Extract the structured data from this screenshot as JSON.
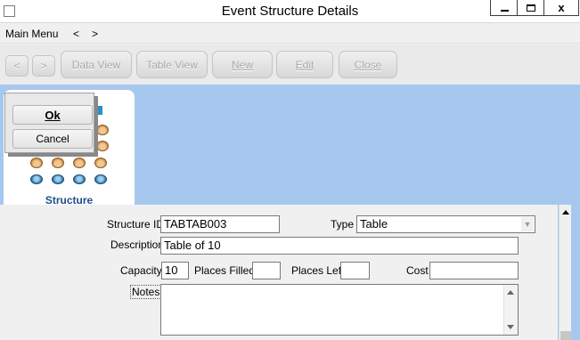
{
  "window": {
    "title": "Event Structure Details",
    "minimize_glyph": "",
    "close_glyph": "x"
  },
  "menu": {
    "main_menu": "Main Menu",
    "back": "<",
    "forward": ">"
  },
  "toolbar": {
    "prev": "<",
    "next": ">",
    "data_view": "Data View",
    "table_view": "Table View",
    "new": "New",
    "edit": "Edit",
    "close": "Close"
  },
  "popup": {
    "ok": "Ok",
    "cancel": "Cancel"
  },
  "tab": {
    "label": "Structure"
  },
  "form": {
    "structure_id_label": "Structure ID",
    "structure_id_value": "TABTAB003",
    "type_label": "Type",
    "type_value": "Table",
    "description_label": "Description",
    "description_value": "Table of 10",
    "capacity_label": "Capacity",
    "capacity_value": "10",
    "places_filled_label": "Places Filled",
    "places_filled_value": "",
    "places_left_label": "Places Left",
    "places_left_value": "",
    "cost_label": "Cost",
    "cost_value": "",
    "notes_label": "Notes",
    "notes_value": ""
  },
  "colors": {
    "background_blue": "#a7c8ee",
    "tab_label_blue": "#1f4e8c",
    "disabled_text": "#a9a9a9"
  }
}
